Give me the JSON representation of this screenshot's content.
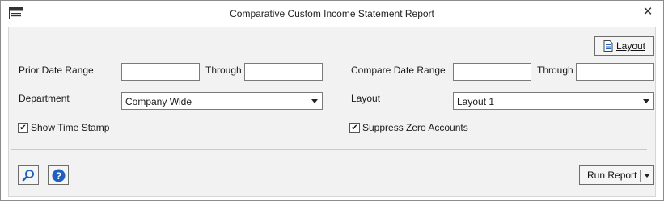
{
  "window": {
    "title": "Comparative Custom Income Statement Report"
  },
  "toolbar": {
    "layout_button_label": "Layout"
  },
  "prior": {
    "label": "Prior Date Range",
    "from_value": "",
    "through_label": "Through",
    "through_value": ""
  },
  "compare": {
    "label": "Compare Date Range",
    "from_value": "",
    "through_label": "Through",
    "through_value": ""
  },
  "department": {
    "label": "Department",
    "selected": "Company Wide"
  },
  "layout_select": {
    "label": "Layout",
    "selected": "Layout 1"
  },
  "options": {
    "show_time_stamp": {
      "label": "Show Time Stamp",
      "checked": true
    },
    "suppress_zero_accounts": {
      "label": "Suppress Zero Accounts",
      "checked": true
    }
  },
  "footer": {
    "run_report_label": "Run Report"
  },
  "icons": {
    "app": "window-icon",
    "close": "close-icon",
    "layout": "document-icon",
    "search": "search-icon",
    "help": "help-icon",
    "dropdown": "chevron-down-icon"
  },
  "colors": {
    "accent_blue": "#1f5fbf",
    "panel_bg": "#f2f2f2"
  }
}
